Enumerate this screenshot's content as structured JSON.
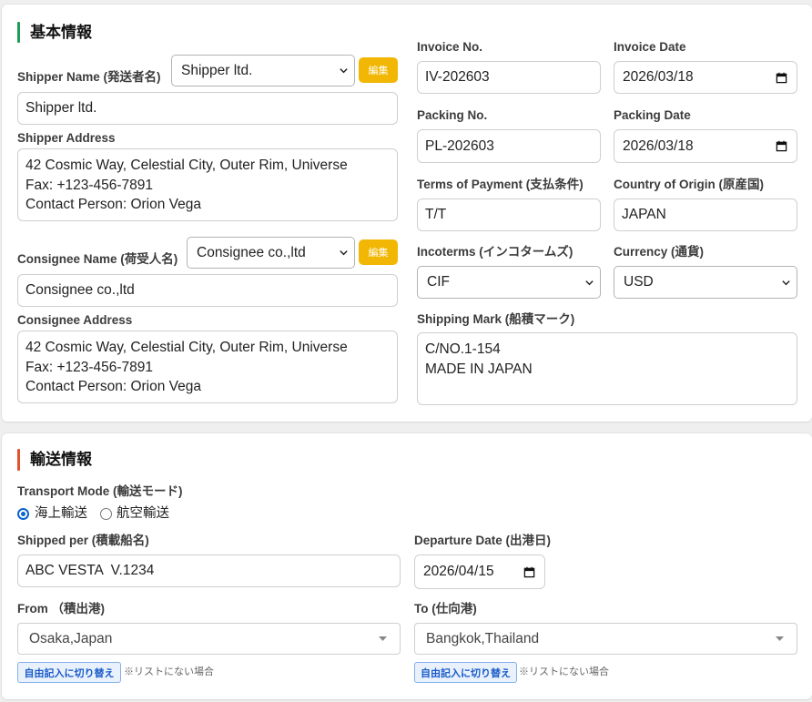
{
  "colors": {
    "page_background": "#efefef",
    "basic_accent": "#1e9b57",
    "transport_accent": "#e2522f",
    "edit_button": "#f2b705",
    "radio_checked": "#0b63ce",
    "switch_button": "#1a5cc8"
  },
  "icons": {
    "select_arrow": "chevron-down-icon",
    "date_picker": "calendar-icon",
    "port_select_arrow": "caret-down-icon"
  },
  "basic_info": {
    "title": "基本情報",
    "shipper": {
      "name_label": "Shipper Name (発送者名)",
      "preset_value": "Shipper ltd.",
      "edit_label": "編集",
      "name_value": "Shipper ltd.",
      "address_label": "Shipper Address",
      "address_value": "42 Cosmic Way, Celestial City, Outer Rim, Universe\nFax: +123-456-7891\nContact Person: Orion Vega"
    },
    "consignee": {
      "name_label": "Consignee Name (荷受人名)",
      "preset_value": "Consignee co.,ltd",
      "edit_label": "編集",
      "name_value": "Consignee co.,ltd",
      "address_label": "Consignee Address",
      "address_value": "42 Cosmic Way, Celestial City, Outer Rim, Universe\nFax: +123-456-7891\nContact Person: Orion Vega"
    },
    "invoice_no": {
      "label": "Invoice No.",
      "value": "IV-202603"
    },
    "invoice_date": {
      "label": "Invoice Date",
      "value": "2026/03/18"
    },
    "packing_no": {
      "label": "Packing No.",
      "value": "PL-202603"
    },
    "packing_date": {
      "label": "Packing Date",
      "value": "2026/03/18"
    },
    "terms_of_payment": {
      "label": "Terms of Payment (支払条件)",
      "value": "T/T"
    },
    "country_of_origin": {
      "label": "Country of Origin (原産国)",
      "value": "JAPAN"
    },
    "incoterms": {
      "label": "Incoterms (インコタームズ)",
      "value": "CIF"
    },
    "currency": {
      "label": "Currency (通貨)",
      "value": "USD"
    },
    "shipping_mark": {
      "label": "Shipping Mark (船積マーク)",
      "value": "C/NO.1-154\nMADE IN JAPAN"
    }
  },
  "transport_info": {
    "title": "輸送情報",
    "transport_mode": {
      "label": "Transport Mode (輸送モード)",
      "options": [
        {
          "label": "海上輸送",
          "checked": true
        },
        {
          "label": "航空輸送",
          "checked": false
        }
      ]
    },
    "shipped_per": {
      "label": "Shipped per (積載船名)",
      "value": "ABC VESTA  V.1234"
    },
    "departure_date": {
      "label": "Departure Date (出港日)",
      "value": "2026/04/15"
    },
    "port_from": {
      "label": "From （積出港)",
      "value": "Osaka,Japan",
      "switch_label": "自由記入に切り替え",
      "note": "※リストにない場合"
    },
    "port_to": {
      "label": "To (仕向港)",
      "value": "Bangkok,Thailand",
      "switch_label": "自由記入に切り替え",
      "note": "※リストにない場合"
    }
  }
}
